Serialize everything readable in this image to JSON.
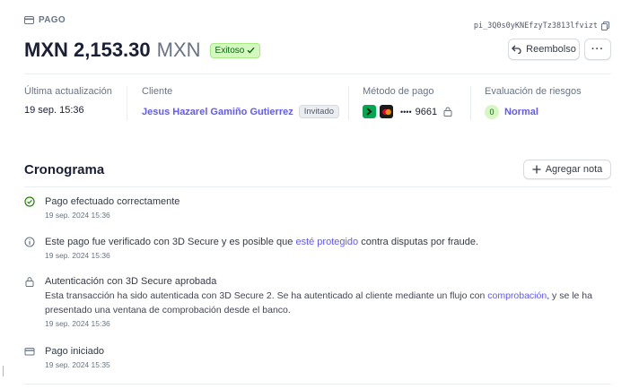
{
  "header": {
    "label": "PAGO",
    "payment_id": "pi_3Q0s0yKNEfzyTz3813lfvizt",
    "amount": "MXN 2,153.30",
    "currency": "MXN",
    "status": "Exitoso",
    "refund_button": "Reembolso",
    "more_button": "···"
  },
  "meta": {
    "updated_label": "Última actualización",
    "updated_value": "19 sep. 15:36",
    "customer_label": "Cliente",
    "customer_name": "Jesus Hazarel Gamiño Gutierrez",
    "customer_badge": "Invitado",
    "method_label": "Método de pago",
    "method_dots": "••••",
    "method_last4": "9661",
    "risk_label": "Evaluación de riesgos",
    "risk_score": "0",
    "risk_value": "Normal"
  },
  "timeline": {
    "title": "Cronograma",
    "add_note": "Agregar nota",
    "events": [
      {
        "title": "Pago efectuado correctamente",
        "time": "19 sep. 2024 15:36"
      },
      {
        "title_pre": "Este pago fue verificado con 3D Secure y es posible que ",
        "title_link": "esté protegido",
        "title_post": " contra disputas por fraude.",
        "time": "19 sep. 2024 15:36"
      },
      {
        "title": "Autenticación con 3D Secure aprobada",
        "desc_pre": "Esta transacción ha sido autenticada con 3D Secure 2. Se ha autenticado al cliente mediante un flujo con ",
        "desc_link": "comprobación",
        "desc_post": ", y se le ha presentado una ventana de comprobación desde el banco.",
        "time": "19 sep. 2024 15:36"
      },
      {
        "title": "Pago iniciado",
        "time": "19 sep. 2024 15:35"
      }
    ]
  },
  "colors": {
    "accent": "#625afa",
    "success_bg": "#d7f7c2",
    "success_text": "#05690d",
    "text": "#1a1f36",
    "muted": "#687385"
  },
  "icons": [
    "card-icon",
    "copy-icon",
    "check-icon",
    "refund-arrow-icon",
    "plus-icon",
    "check-circle-icon",
    "info-circle-icon",
    "lock-icon",
    "card-outline-icon",
    "link-icon",
    "mastercard-icon"
  ]
}
